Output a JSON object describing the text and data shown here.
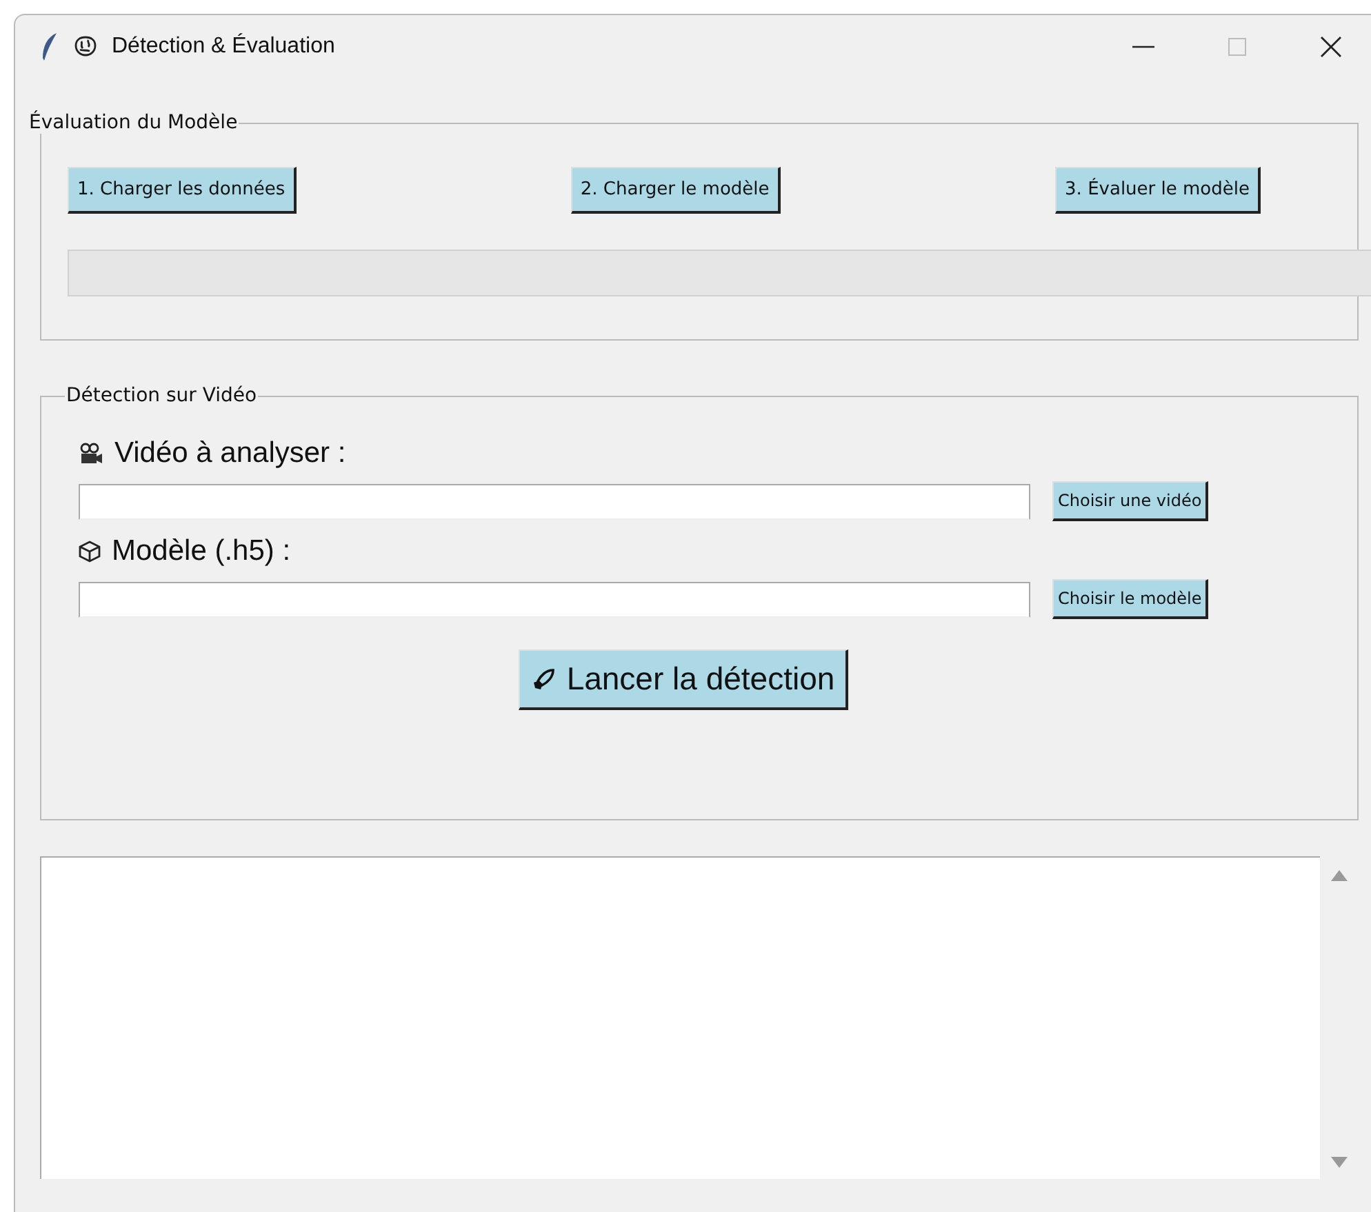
{
  "window": {
    "title": "Détection & Évaluation"
  },
  "evaluation": {
    "title": "Évaluation du Modèle",
    "buttons": [
      "1. Charger les données",
      "2. Charger le modèle",
      "3. Évaluer le modèle"
    ],
    "progress": {
      "level": 0
    }
  },
  "detection": {
    "title": "Détection sur Vidéo",
    "fields": [
      {
        "kind": "video",
        "label": "Vidéo à analyser :",
        "button": "Choisir une vidéo"
      },
      {
        "kind": "model",
        "label": "Modèle  (.h5) :",
        "button": "Choisir le modèle"
      }
    ],
    "launch_button": "Lancer la détection"
  }
}
